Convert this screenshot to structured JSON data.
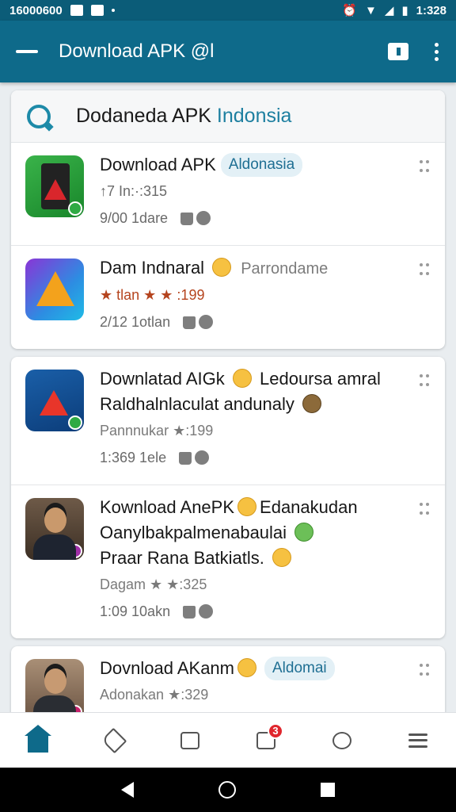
{
  "status_bar": {
    "time_left": "16000600",
    "time_right": "1:328"
  },
  "app_bar": {
    "title": "Download APK @l"
  },
  "section": {
    "title_main": "Dodaneda APK ",
    "title_accent": "Indonsia"
  },
  "items": [
    {
      "lines": [
        "Download APK"
      ],
      "chip": "Aldonasia",
      "meta1": "↑7 In:·:315",
      "meta2": "9/00 1dare",
      "thumb": "green-phone-icon"
    },
    {
      "lines": [
        "Dam Indnaral"
      ],
      "chip_plain": "Parrondame",
      "meta1": "★ tlan ★ ★ :199",
      "meta2": "2/12 1otlan",
      "thumb": "prism-icon"
    },
    {
      "lines": [
        "Downlatad AIGk",
        "Raldhalnlaculat andunaly"
      ],
      "line1_suffix": "Ledoursa amral",
      "meta1": "Pannnukar ★:199",
      "meta2": "1:369 1ele",
      "thumb": "blue-app-icon"
    },
    {
      "lines": [
        "Kownload AnePK",
        "Oanylbakpalmenabaulai",
        "Praar Rana Batkiatls."
      ],
      "line1_suffix": "Edanakudan",
      "meta1": "Dagam ★ ★:325",
      "meta2": "1:09 10akn",
      "thumb": "person-photo"
    },
    {
      "lines": [
        "Dovnload AKanm"
      ],
      "chip": "Aldomai",
      "meta1": "Adonakan ★:329",
      "thumb": "person-photo-2"
    }
  ],
  "bottom_nav": {
    "items": [
      "home-icon",
      "send-icon",
      "shield-icon",
      "bag-icon",
      "heart-icon",
      "menu-icon"
    ],
    "badge": "3"
  },
  "colors": {
    "primary": "#0e6a8a",
    "accent": "#1d7fa0",
    "rating": "#b5441e",
    "badge": "#e0262d"
  }
}
